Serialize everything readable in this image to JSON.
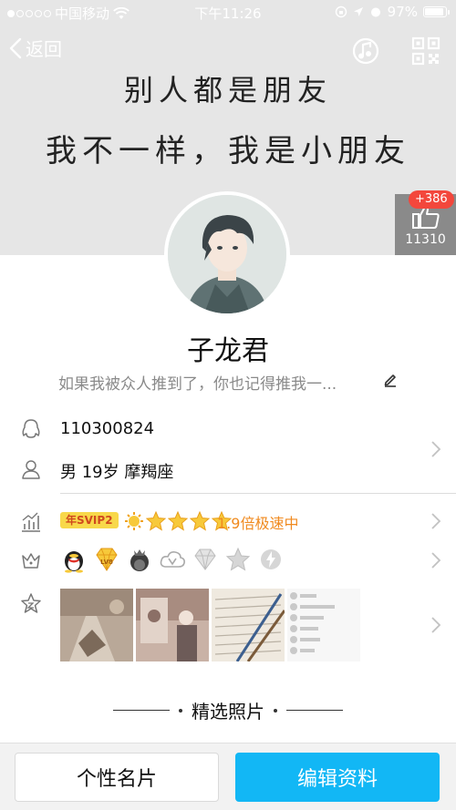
{
  "status_bar": {
    "carrier": "中国移动",
    "time": "下午11:26",
    "battery": "97%",
    "battery_level": 0.97
  },
  "nav": {
    "back_label": "返回"
  },
  "cover": {
    "line1": "别人都是朋友",
    "line2": "我不一样，我是小朋友"
  },
  "like": {
    "badge": "+386",
    "count": "11310"
  },
  "profile": {
    "name": "子龙君",
    "signature": "如果我被众人推到了，你也记得推我一..."
  },
  "info": {
    "qq_number": "110300824",
    "details": "男 19岁 摩羯座"
  },
  "vip": {
    "badge": "年SVIP2",
    "speed": "1.9倍极速中"
  },
  "featured": {
    "title": "精选照片"
  },
  "buttons": {
    "card_label": "个性名片",
    "edit_label": "编辑资料"
  },
  "colors": {
    "accent": "#12b7f5",
    "badge_red": "#f3473c",
    "vip_orange": "#f08a1f"
  },
  "icons": {
    "music": "music-note-icon",
    "qr": "qr-code-icon",
    "like": "thumbs-up-icon",
    "qq": "qq-penguin-icon",
    "person": "person-icon",
    "level": "level-chart-icon",
    "crown": "crown-icon",
    "star": "star-badge-icon",
    "edit": "pencil-icon",
    "chevron": "chevron-right-icon"
  }
}
